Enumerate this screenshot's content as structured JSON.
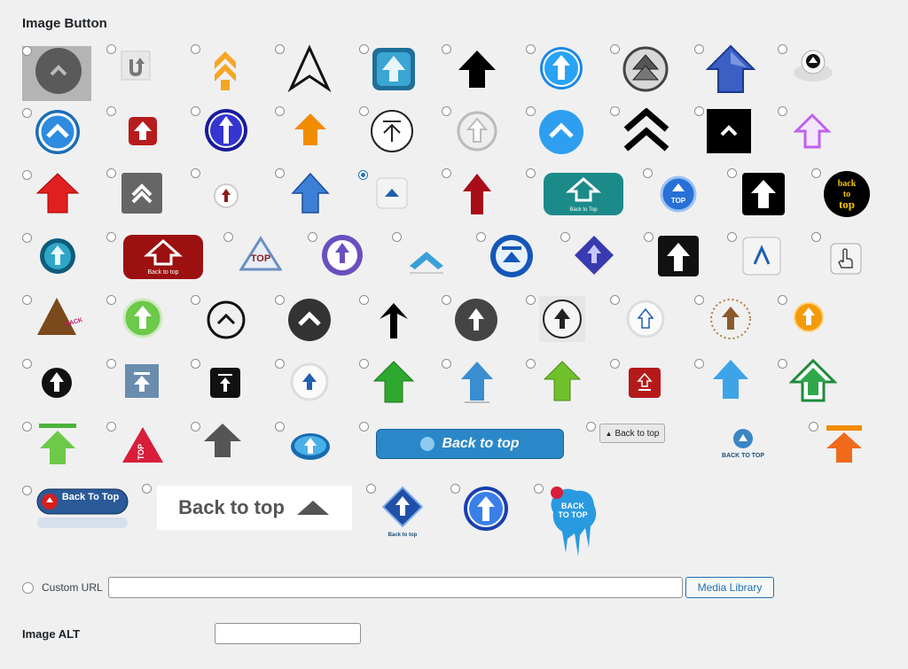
{
  "section_title": "Image Button",
  "custom_url_label": "Custom URL",
  "custom_url_value": "",
  "media_library_label": "Media Library",
  "image_alt_label": "Image ALT",
  "image_alt_value": "",
  "icon_texts": {
    "back_to_top_lower": "Back to Top",
    "back_to_top_glossy": "Back to top",
    "back_to_top_small_btn": "Back to top",
    "back_to_top_caps": "BACK TO TOP",
    "back_to_top_pill": "Back To Top",
    "back_to_top_wide": "Back to top",
    "back_to_top_diamond": "Back to top",
    "back_to_top_splash": "BACK TO TOP",
    "top_blue_circle": "TOP",
    "top_triangle": "TOP",
    "top_red_triangle": "TOP",
    "back_to_top_black_circle": "back to top",
    "back_to_top_brown_triangle": "BACK TO TOP",
    "back_to_top_red_banner": "Back to top"
  },
  "selected_index": 24,
  "colors": {
    "accent": "#2271b1",
    "background": "#f0f0f1"
  }
}
